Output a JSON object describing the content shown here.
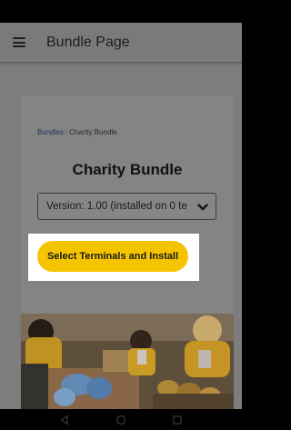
{
  "app_bar": {
    "title": "Bundle Page",
    "menu_icon": "hamburger-menu-icon"
  },
  "breadcrumb": {
    "link": "Bundles",
    "separator": "/",
    "current": "Charity Bundle"
  },
  "bundle": {
    "title": "Charity Bundle",
    "version_select_value": "Version: 1.00 (installed on 0 te"
  },
  "install_button": {
    "label": "Select Terminals and Install"
  },
  "nav_bar": {
    "icons": [
      "back-triangle-icon",
      "home-circle-icon",
      "recents-square-icon"
    ]
  },
  "colors": {
    "accent": "#f5c400",
    "link": "#1f2e57",
    "overlay": "#7d7d7d"
  }
}
